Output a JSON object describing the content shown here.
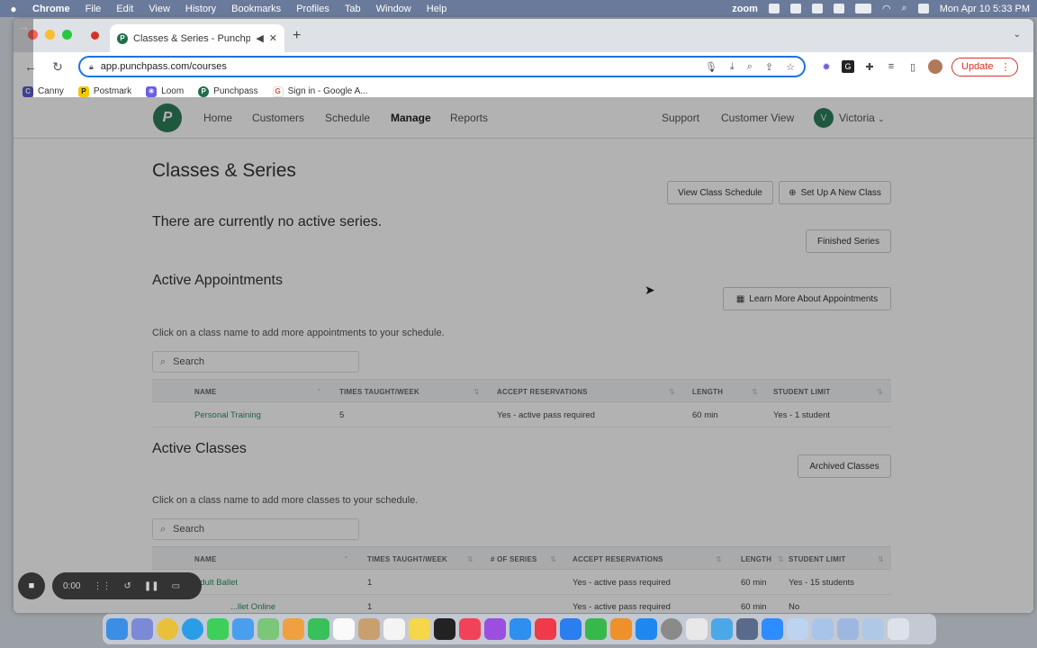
{
  "menubar": {
    "apple": "",
    "app": "Chrome",
    "items": [
      "File",
      "Edit",
      "View",
      "History",
      "Bookmarks",
      "Profiles",
      "Tab",
      "Window",
      "Help"
    ],
    "zoom": "zoom",
    "clock": "Mon Apr 10  5:33 PM"
  },
  "browser": {
    "tab_title": "Classes & Series - Punchp",
    "new_tab": "+",
    "url": "app.punchpass.com/courses",
    "update_label": "Update",
    "bookmarks": [
      {
        "label": "Canny",
        "color": "#5b5bd6",
        "glyph": "C"
      },
      {
        "label": "Postmark",
        "color": "#f7c600",
        "glyph": "P"
      },
      {
        "label": "Loom",
        "color": "#6c5ce7",
        "glyph": "✳"
      },
      {
        "label": "Punchpass",
        "color": "#1e6e4a",
        "glyph": "P"
      },
      {
        "label": "Sign in - Google A...",
        "color": "#ea4335",
        "glyph": "G"
      }
    ]
  },
  "nav": {
    "logo": "P",
    "links": [
      "Home",
      "Customers",
      "Schedule",
      "Manage",
      "Reports"
    ],
    "active": "Manage",
    "support": "Support",
    "customer_view": "Customer View",
    "user": "Victoria",
    "user_initial": "V"
  },
  "page": {
    "title": "Classes & Series",
    "view_schedule": "View Class Schedule",
    "setup_class": "Set Up A New Class",
    "no_series": "There are currently no active series.",
    "finished_series": "Finished Series",
    "appointments": {
      "title": "Active Appointments",
      "learn_more": "Learn More About Appointments",
      "subtitle": "Click on a class name to add more appointments to your schedule.",
      "search_placeholder": "Search",
      "headers": [
        "NAME",
        "TIMES TAUGHT/WEEK",
        "ACCEPT RESERVATIONS",
        "LENGTH",
        "STUDENT LIMIT"
      ],
      "rows": [
        {
          "name": "Personal Training",
          "times": "5",
          "accept": "Yes - active pass required",
          "length": "60 min",
          "limit": "Yes - 1 student"
        }
      ]
    },
    "classes": {
      "title": "Active Classes",
      "archived": "Archived Classes",
      "subtitle": "Click on a class name to add more classes to your schedule.",
      "search_placeholder": "Search",
      "headers": [
        "NAME",
        "TIMES TAUGHT/WEEK",
        "# OF SERIES",
        "ACCEPT RESERVATIONS",
        "LENGTH",
        "STUDENT LIMIT"
      ],
      "rows": [
        {
          "name": "Adult Ballet",
          "times": "1",
          "accept": "Yes - active pass required",
          "length": "60 min",
          "limit": "Yes - 15 students"
        },
        {
          "name": "...llet Online",
          "times": "1",
          "accept": "Yes - active pass required",
          "length": "60 min",
          "limit": "No"
        }
      ]
    }
  },
  "recorder": {
    "time": "0:00"
  },
  "colors": {
    "brand": "#2f7d5b",
    "link": "#2f8f5f",
    "accent": "#1a73e8"
  }
}
